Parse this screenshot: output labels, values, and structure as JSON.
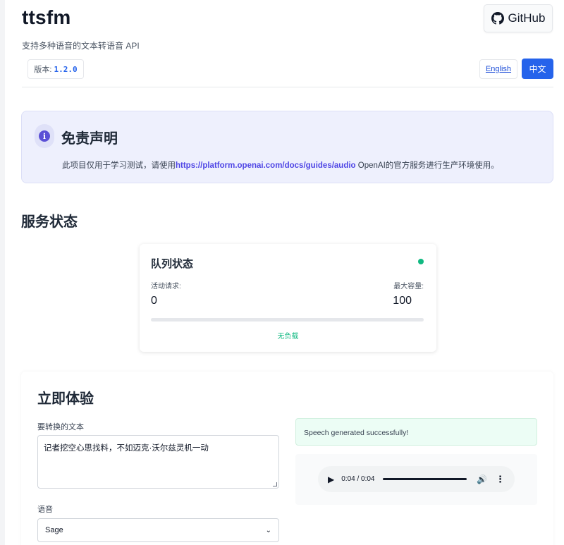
{
  "header": {
    "title": "ttsfm",
    "tagline": "支持多种语音的文本转语音 API",
    "github_label": "GitHub",
    "version_label": "版本:",
    "version_value": "1.2.0",
    "lang_english": "English",
    "lang_chinese": "中文"
  },
  "disclaimer": {
    "title": "免责声明",
    "text_before": "此项目仅用于学习测试，请使用",
    "link": "https://platform.openai.com/docs/guides/audio",
    "text_after": " OpenAI的官方服务进行生产环境使用。"
  },
  "service_status": {
    "title": "服务状态",
    "queue": {
      "title": "队列状态",
      "active_label": "活动请求:",
      "active_value": "0",
      "max_label": "最大容量:",
      "max_value": "100",
      "load_fraction": 0,
      "status_text": "无负载",
      "status_color": "#10b981"
    }
  },
  "try_now": {
    "title": "立即体验",
    "text_label": "要转换的文本",
    "text_value": "记者挖空心思找料，不如迈克·沃尔兹灵机一动",
    "voice_label": "语音",
    "voice_value": "Sage",
    "success_message": "Speech generated successfully!",
    "audio_time": "0:04 / 0:04"
  },
  "colors": {
    "accent": "#2563eb",
    "success": "#10b981",
    "disclaimer_bg": "#eef0fd"
  }
}
